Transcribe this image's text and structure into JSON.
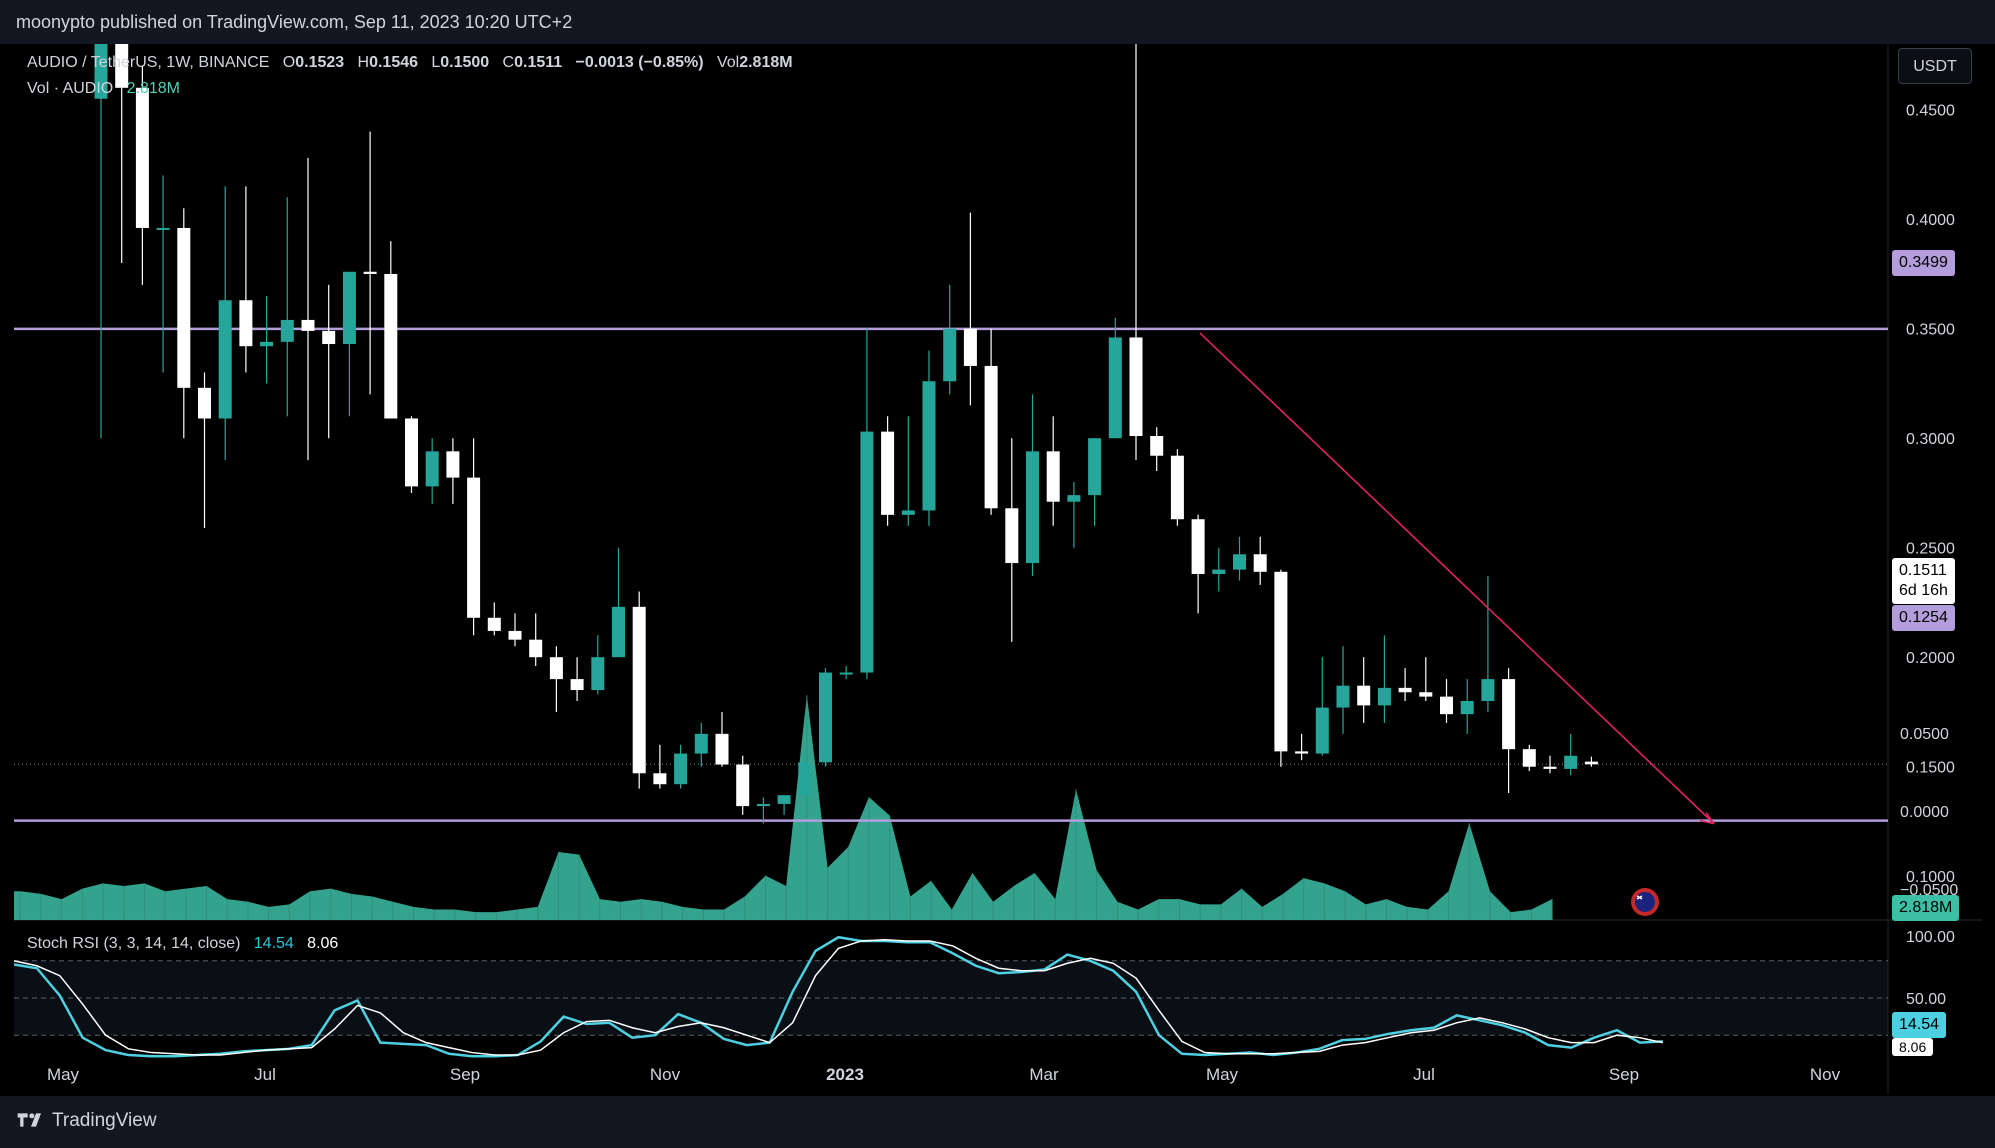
{
  "header": {
    "published_by": "moonypto published on TradingView.com, Sep 11, 2023 10:20 UTC+2"
  },
  "currency_button": "USDT",
  "legend": {
    "symbol": "AUDIO / TetherUS, 1W, BINANCE",
    "o_label": "O",
    "o": "0.1523",
    "h_label": "H",
    "h": "0.1546",
    "l_label": "L",
    "l": "0.1500",
    "c_label": "C",
    "c": "0.1511",
    "change": "−0.0013 (−0.85%)",
    "vol_label": "Vol",
    "vol": "2.818M",
    "volume_label": "Vol · AUDIO",
    "volume_value": "2.818M",
    "stoch_label": "Stoch RSI (3, 3, 14, 14, close)",
    "stoch_k": "14.54",
    "stoch_d": "8.06"
  },
  "price_tags": {
    "resistance": "0.3499",
    "support": "0.1254",
    "last": "0.1511",
    "countdown": "6d 16h",
    "volume": "2.818M",
    "stoch_k": "14.54",
    "stoch_d": "8.06"
  },
  "footer": {
    "brand": "TradingView"
  },
  "colors": {
    "up": "#26a69a",
    "down": "#ffffff",
    "level": "#b39ddb",
    "trend": "#e0245e",
    "volume": "#3dbfa6",
    "stoch_k": "#4dd0e1",
    "stoch_d": "#ffffff"
  },
  "chart_data": [
    {
      "type": "candlestick",
      "title": "AUDIO / TetherUS, 1W, BINANCE",
      "ylim": [
        0.08,
        0.48
      ],
      "price_axis_ticks": [
        "0.4500",
        "0.4000",
        "0.3500",
        "0.3000",
        "0.2500",
        "0.2000",
        "0.1500",
        "0.1000"
      ],
      "time_axis_ticks": [
        "May",
        "Jul",
        "Sep",
        "Nov",
        "2023",
        "Mar",
        "May",
        "Jul",
        "Sep",
        "Nov"
      ],
      "levels": [
        0.3499,
        0.1254
      ],
      "trendline": [
        [
          "2023-04-24",
          0.348
        ],
        [
          "2023-09-18",
          0.124
        ]
      ],
      "candles": [
        {
          "o": 0.455,
          "h": 0.53,
          "l": 0.3,
          "c": 0.505
        },
        {
          "o": 0.505,
          "h": 0.53,
          "l": 0.38,
          "c": 0.46
        },
        {
          "o": 0.46,
          "h": 0.47,
          "l": 0.37,
          "c": 0.396
        },
        {
          "o": 0.396,
          "h": 0.42,
          "l": 0.33,
          "c": 0.396
        },
        {
          "o": 0.396,
          "h": 0.405,
          "l": 0.3,
          "c": 0.323
        },
        {
          "o": 0.323,
          "h": 0.33,
          "l": 0.259,
          "c": 0.309
        },
        {
          "o": 0.309,
          "h": 0.415,
          "l": 0.29,
          "c": 0.363
        },
        {
          "o": 0.363,
          "h": 0.415,
          "l": 0.33,
          "c": 0.342
        },
        {
          "o": 0.342,
          "h": 0.365,
          "l": 0.325,
          "c": 0.344
        },
        {
          "o": 0.344,
          "h": 0.41,
          "l": 0.31,
          "c": 0.354
        },
        {
          "o": 0.354,
          "h": 0.428,
          "l": 0.29,
          "c": 0.349
        },
        {
          "o": 0.349,
          "h": 0.37,
          "l": 0.3,
          "c": 0.343
        },
        {
          "o": 0.343,
          "h": 0.37,
          "l": 0.31,
          "c": 0.376
        },
        {
          "o": 0.376,
          "h": 0.44,
          "l": 0.32,
          "c": 0.375
        },
        {
          "o": 0.375,
          "h": 0.39,
          "l": 0.31,
          "c": 0.309
        },
        {
          "o": 0.309,
          "h": 0.31,
          "l": 0.275,
          "c": 0.278
        },
        {
          "o": 0.278,
          "h": 0.3,
          "l": 0.27,
          "c": 0.294
        },
        {
          "o": 0.294,
          "h": 0.3,
          "l": 0.27,
          "c": 0.282
        },
        {
          "o": 0.282,
          "h": 0.3,
          "l": 0.21,
          "c": 0.218
        },
        {
          "o": 0.218,
          "h": 0.225,
          "l": 0.21,
          "c": 0.212
        },
        {
          "o": 0.212,
          "h": 0.22,
          "l": 0.205,
          "c": 0.208
        },
        {
          "o": 0.208,
          "h": 0.22,
          "l": 0.196,
          "c": 0.2
        },
        {
          "o": 0.2,
          "h": 0.205,
          "l": 0.175,
          "c": 0.19
        },
        {
          "o": 0.19,
          "h": 0.2,
          "l": 0.18,
          "c": 0.185
        },
        {
          "o": 0.185,
          "h": 0.21,
          "l": 0.183,
          "c": 0.2
        },
        {
          "o": 0.2,
          "h": 0.25,
          "l": 0.2,
          "c": 0.223
        },
        {
          "o": 0.223,
          "h": 0.23,
          "l": 0.14,
          "c": 0.147
        },
        {
          "o": 0.147,
          "h": 0.16,
          "l": 0.14,
          "c": 0.142
        },
        {
          "o": 0.142,
          "h": 0.16,
          "l": 0.14,
          "c": 0.156
        },
        {
          "o": 0.156,
          "h": 0.17,
          "l": 0.15,
          "c": 0.165
        },
        {
          "o": 0.165,
          "h": 0.175,
          "l": 0.15,
          "c": 0.151
        },
        {
          "o": 0.151,
          "h": 0.155,
          "l": 0.128,
          "c": 0.132
        },
        {
          "o": 0.132,
          "h": 0.136,
          "l": 0.124,
          "c": 0.133
        },
        {
          "o": 0.133,
          "h": 0.137,
          "l": 0.128,
          "c": 0.137
        },
        {
          "o": 0.137,
          "h": 0.155,
          "l": 0.13,
          "c": 0.152
        },
        {
          "o": 0.152,
          "h": 0.195,
          "l": 0.15,
          "c": 0.193
        },
        {
          "o": 0.193,
          "h": 0.196,
          "l": 0.19,
          "c": 0.193
        },
        {
          "o": 0.193,
          "h": 0.35,
          "l": 0.19,
          "c": 0.303
        },
        {
          "o": 0.303,
          "h": 0.31,
          "l": 0.26,
          "c": 0.265
        },
        {
          "o": 0.265,
          "h": 0.31,
          "l": 0.26,
          "c": 0.267
        },
        {
          "o": 0.267,
          "h": 0.34,
          "l": 0.26,
          "c": 0.326
        },
        {
          "o": 0.326,
          "h": 0.37,
          "l": 0.32,
          "c": 0.35
        },
        {
          "o": 0.35,
          "h": 0.403,
          "l": 0.315,
          "c": 0.333
        },
        {
          "o": 0.333,
          "h": 0.35,
          "l": 0.265,
          "c": 0.268
        },
        {
          "o": 0.268,
          "h": 0.3,
          "l": 0.207,
          "c": 0.243
        },
        {
          "o": 0.243,
          "h": 0.32,
          "l": 0.237,
          "c": 0.294
        },
        {
          "o": 0.294,
          "h": 0.31,
          "l": 0.26,
          "c": 0.271
        },
        {
          "o": 0.271,
          "h": 0.28,
          "l": 0.25,
          "c": 0.274
        },
        {
          "o": 0.274,
          "h": 0.3,
          "l": 0.26,
          "c": 0.3
        },
        {
          "o": 0.3,
          "h": 0.355,
          "l": 0.3,
          "c": 0.346
        },
        {
          "o": 0.346,
          "h": 0.53,
          "l": 0.29,
          "c": 0.301
        },
        {
          "o": 0.301,
          "h": 0.305,
          "l": 0.285,
          "c": 0.292
        },
        {
          "o": 0.292,
          "h": 0.295,
          "l": 0.26,
          "c": 0.263
        },
        {
          "o": 0.263,
          "h": 0.265,
          "l": 0.22,
          "c": 0.238
        },
        {
          "o": 0.238,
          "h": 0.25,
          "l": 0.23,
          "c": 0.24
        },
        {
          "o": 0.24,
          "h": 0.255,
          "l": 0.235,
          "c": 0.247
        },
        {
          "o": 0.247,
          "h": 0.255,
          "l": 0.233,
          "c": 0.239
        },
        {
          "o": 0.239,
          "h": 0.24,
          "l": 0.15,
          "c": 0.157
        },
        {
          "o": 0.157,
          "h": 0.165,
          "l": 0.153,
          "c": 0.156
        },
        {
          "o": 0.156,
          "h": 0.2,
          "l": 0.155,
          "c": 0.177
        },
        {
          "o": 0.177,
          "h": 0.205,
          "l": 0.165,
          "c": 0.187
        },
        {
          "o": 0.187,
          "h": 0.2,
          "l": 0.17,
          "c": 0.178
        },
        {
          "o": 0.178,
          "h": 0.21,
          "l": 0.17,
          "c": 0.186
        },
        {
          "o": 0.186,
          "h": 0.195,
          "l": 0.18,
          "c": 0.184
        },
        {
          "o": 0.184,
          "h": 0.2,
          "l": 0.18,
          "c": 0.182
        },
        {
          "o": 0.182,
          "h": 0.19,
          "l": 0.17,
          "c": 0.174
        },
        {
          "o": 0.174,
          "h": 0.19,
          "l": 0.165,
          "c": 0.18
        },
        {
          "o": 0.18,
          "h": 0.237,
          "l": 0.175,
          "c": 0.19
        },
        {
          "o": 0.19,
          "h": 0.195,
          "l": 0.138,
          "c": 0.158
        },
        {
          "o": 0.158,
          "h": 0.16,
          "l": 0.148,
          "c": 0.15
        },
        {
          "o": 0.15,
          "h": 0.155,
          "l": 0.147,
          "c": 0.149
        },
        {
          "o": 0.149,
          "h": 0.165,
          "l": 0.146,
          "c": 0.155
        },
        {
          "o": 0.1523,
          "h": 0.1546,
          "l": 0.15,
          "c": 0.1511
        }
      ]
    },
    {
      "type": "area",
      "title": "Vol · AUDIO",
      "values": [
        11,
        10,
        8,
        12,
        14,
        13,
        14,
        11,
        12,
        13,
        8,
        7,
        5,
        6,
        11,
        12,
        10,
        9,
        7,
        5,
        4,
        4,
        3,
        3,
        4,
        5,
        26,
        25,
        8,
        7,
        8,
        7,
        5,
        4,
        4,
        9,
        17,
        13,
        86,
        20,
        28,
        47,
        40,
        9,
        15,
        4,
        18,
        7,
        13,
        18,
        8,
        50,
        19,
        7,
        4,
        8,
        8,
        6,
        6,
        12,
        5,
        10,
        16,
        14,
        11,
        6,
        8,
        5,
        4,
        11,
        37,
        11,
        3,
        4,
        8
      ]
    },
    {
      "type": "line",
      "title": "Stoch RSI (3, 3, 14, 14, close)",
      "ylim": [
        0,
        100
      ],
      "ticks": [
        "100.00",
        "50.00"
      ],
      "series": [
        {
          "name": "K",
          "values": [
            77,
            74,
            52,
            18,
            8,
            4,
            3,
            3,
            4,
            5,
            7,
            8,
            9,
            12,
            40,
            48,
            14,
            13,
            12,
            5,
            3,
            3,
            4,
            15,
            35,
            29,
            30,
            18,
            20,
            37,
            30,
            17,
            12,
            14,
            55,
            88,
            99,
            96,
            96,
            95,
            95,
            86,
            76,
            70,
            71,
            73,
            85,
            80,
            72,
            55,
            20,
            5,
            4,
            5,
            6,
            4,
            6,
            9,
            16,
            17,
            21,
            24,
            26,
            36,
            32,
            28,
            22,
            12,
            10,
            18,
            24,
            14,
            15
          ]
        },
        {
          "name": "D",
          "values": [
            80,
            76,
            68,
            45,
            20,
            9,
            6,
            5,
            4,
            4,
            6,
            8,
            9,
            10,
            25,
            44,
            38,
            22,
            14,
            10,
            6,
            4,
            4,
            8,
            22,
            31,
            32,
            26,
            22,
            27,
            30,
            26,
            20,
            14,
            30,
            68,
            90,
            96,
            97,
            96,
            96,
            92,
            82,
            74,
            72,
            72,
            78,
            82,
            78,
            66,
            40,
            15,
            6,
            5,
            5,
            5,
            6,
            7,
            12,
            14,
            18,
            22,
            24,
            30,
            34,
            30,
            25,
            18,
            14,
            14,
            20,
            18,
            14
          ]
        }
      ]
    }
  ]
}
